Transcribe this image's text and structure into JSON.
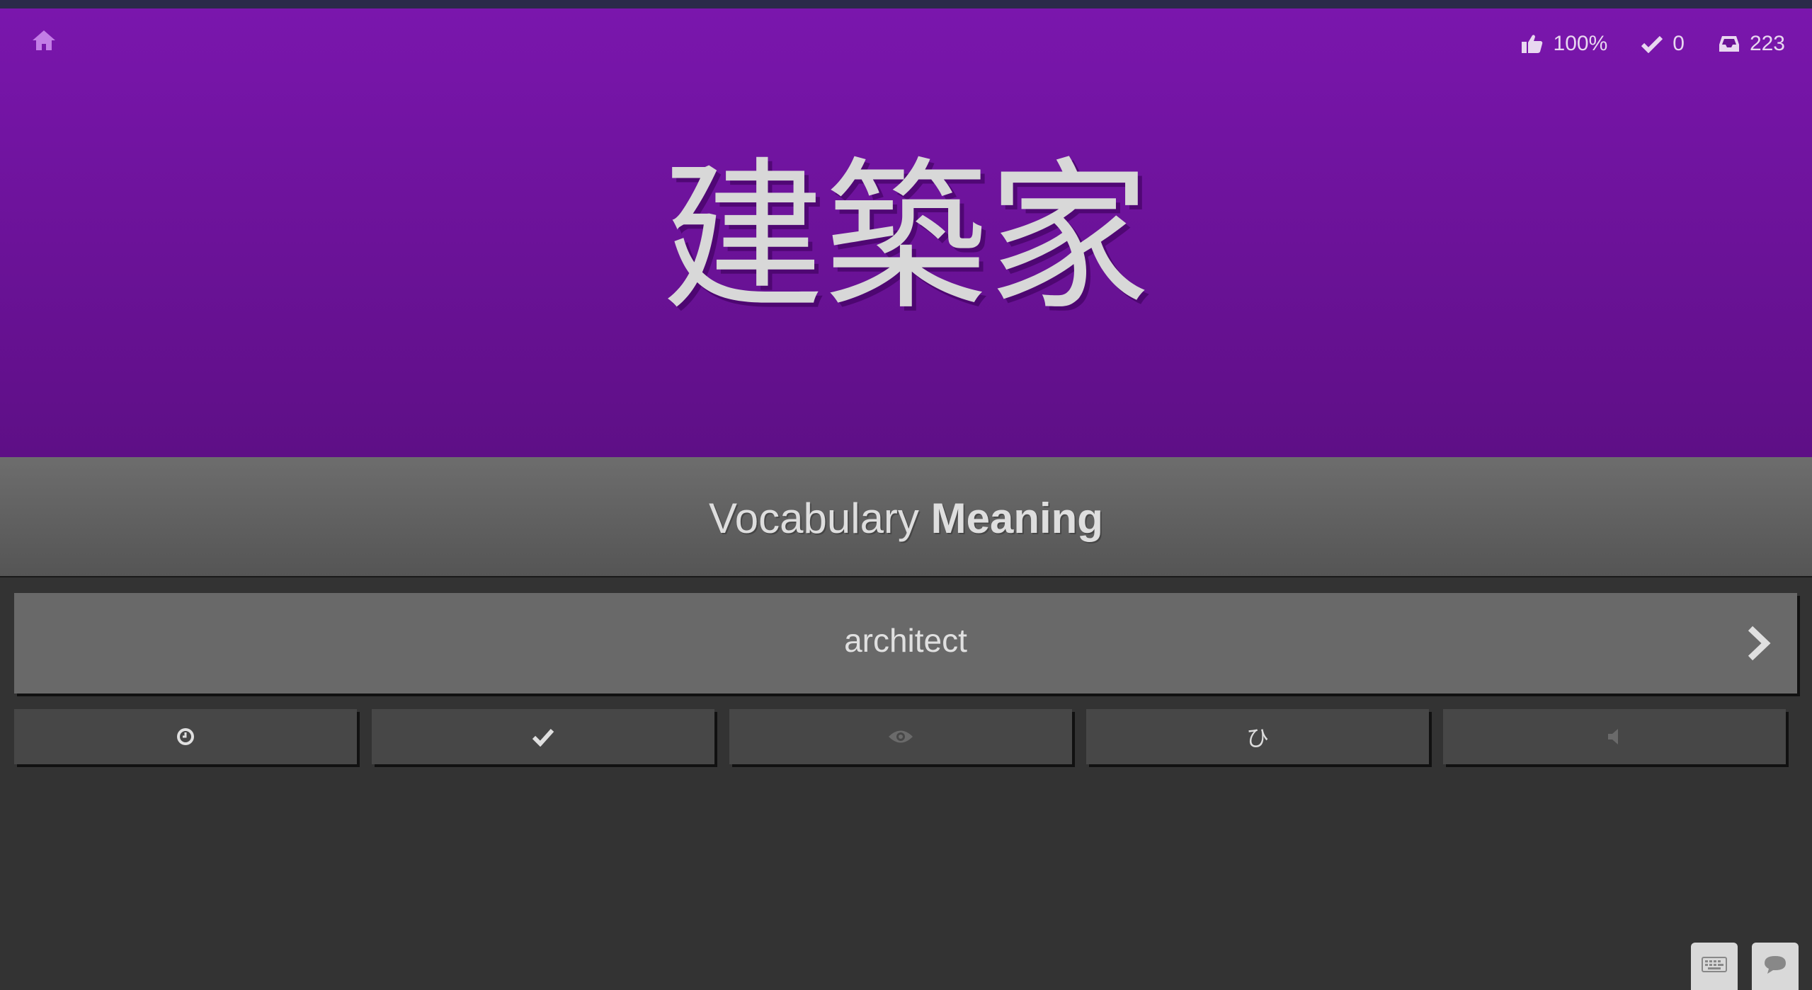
{
  "header": {
    "home_icon": "home-icon",
    "stats": {
      "percent": "100%",
      "done": "0",
      "queue": "223"
    },
    "character": "建築家",
    "accent_color": "#7a16ad"
  },
  "question": {
    "type_label": "Vocabulary",
    "category_label": "Meaning"
  },
  "answer": {
    "value": "architect",
    "submit_icon": "chevron-right-icon"
  },
  "buttons": {
    "hiragana_glyph": "ひ",
    "icons": [
      "clock-icon",
      "check-icon",
      "eye-icon",
      "hiragana-icon",
      "audio-icon"
    ]
  },
  "corner": {
    "icons": [
      "keyboard-icon",
      "chat-icon"
    ]
  }
}
